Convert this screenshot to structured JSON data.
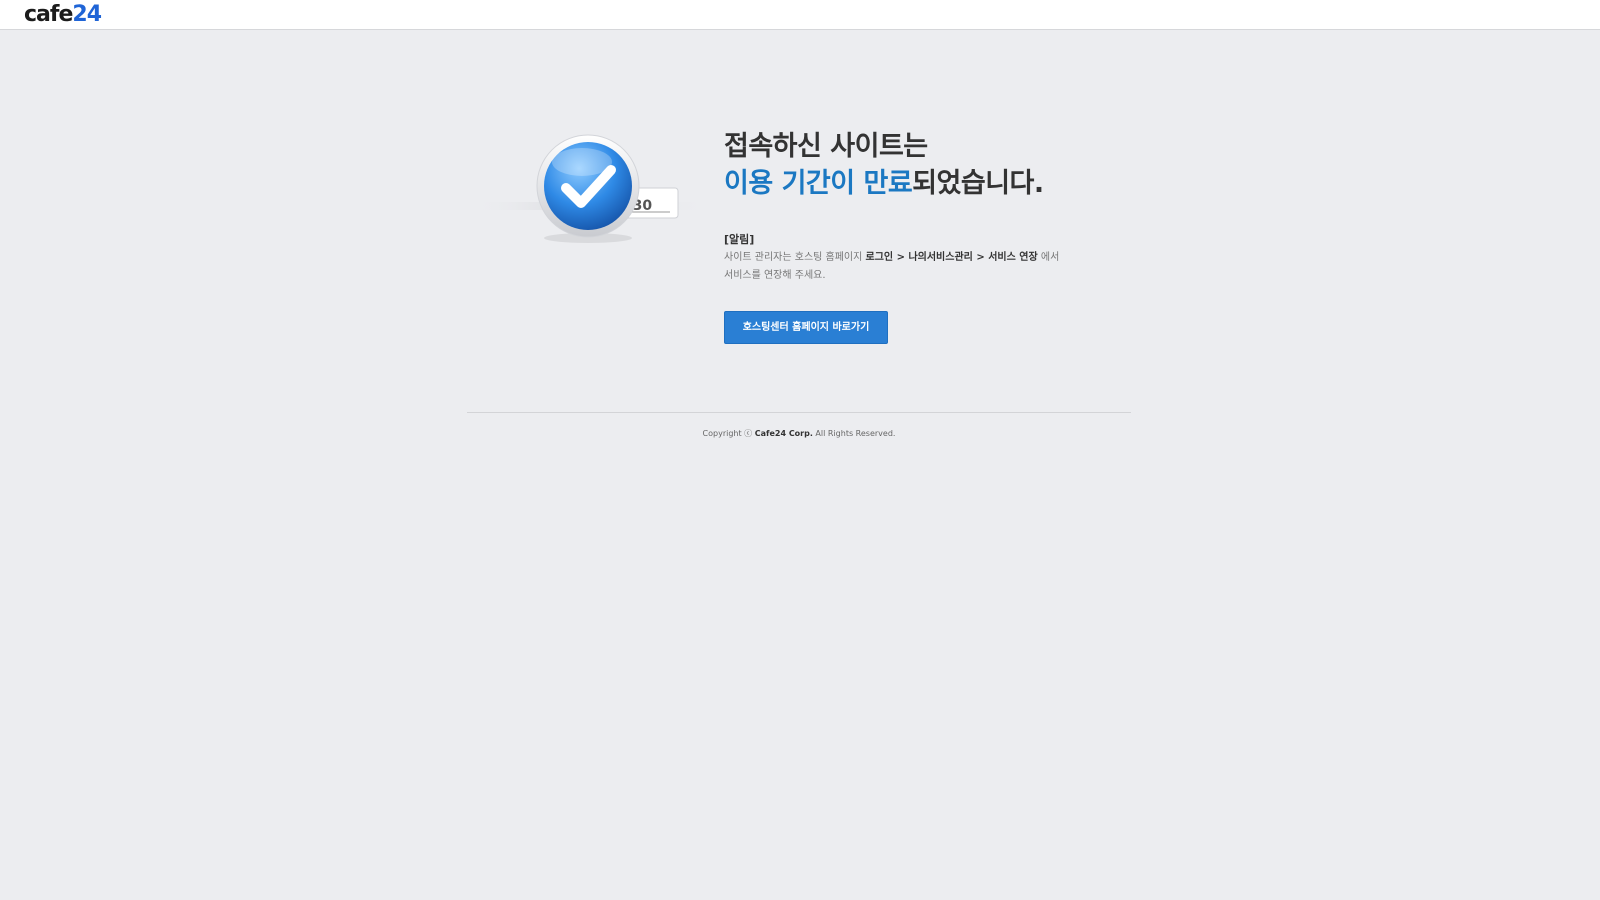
{
  "header": {
    "logo_part1": "cafe",
    "logo_part2": "24"
  },
  "illustration": {
    "tag_text": "AY.30",
    "icon": "check-icon"
  },
  "headline": {
    "line1": "접속하신 사이트는",
    "line2_highlight": "이용 기간이 만료",
    "line2_rest": "되었습니다."
  },
  "notice": {
    "title": "[알림]",
    "text_prefix": "사이트 관리자는 호스팅 홈페이지 ",
    "path": "로그인 > 나의서비스관리 > 서비스 연장",
    "text_suffix": " 에서",
    "line2": "서비스를 연장해 주세요."
  },
  "button": {
    "label": "호스팅센터 홈페이지 바로가기"
  },
  "footer": {
    "copyright_prefix": "Copyright ⓒ ",
    "company": "Cafe24 Corp.",
    "copyright_suffix": " All Rights Reserved."
  },
  "colors": {
    "background": "#ecedf0",
    "accent": "#1b78c2",
    "button": "#2a7fd4",
    "logo_blue": "#1f64d6"
  }
}
